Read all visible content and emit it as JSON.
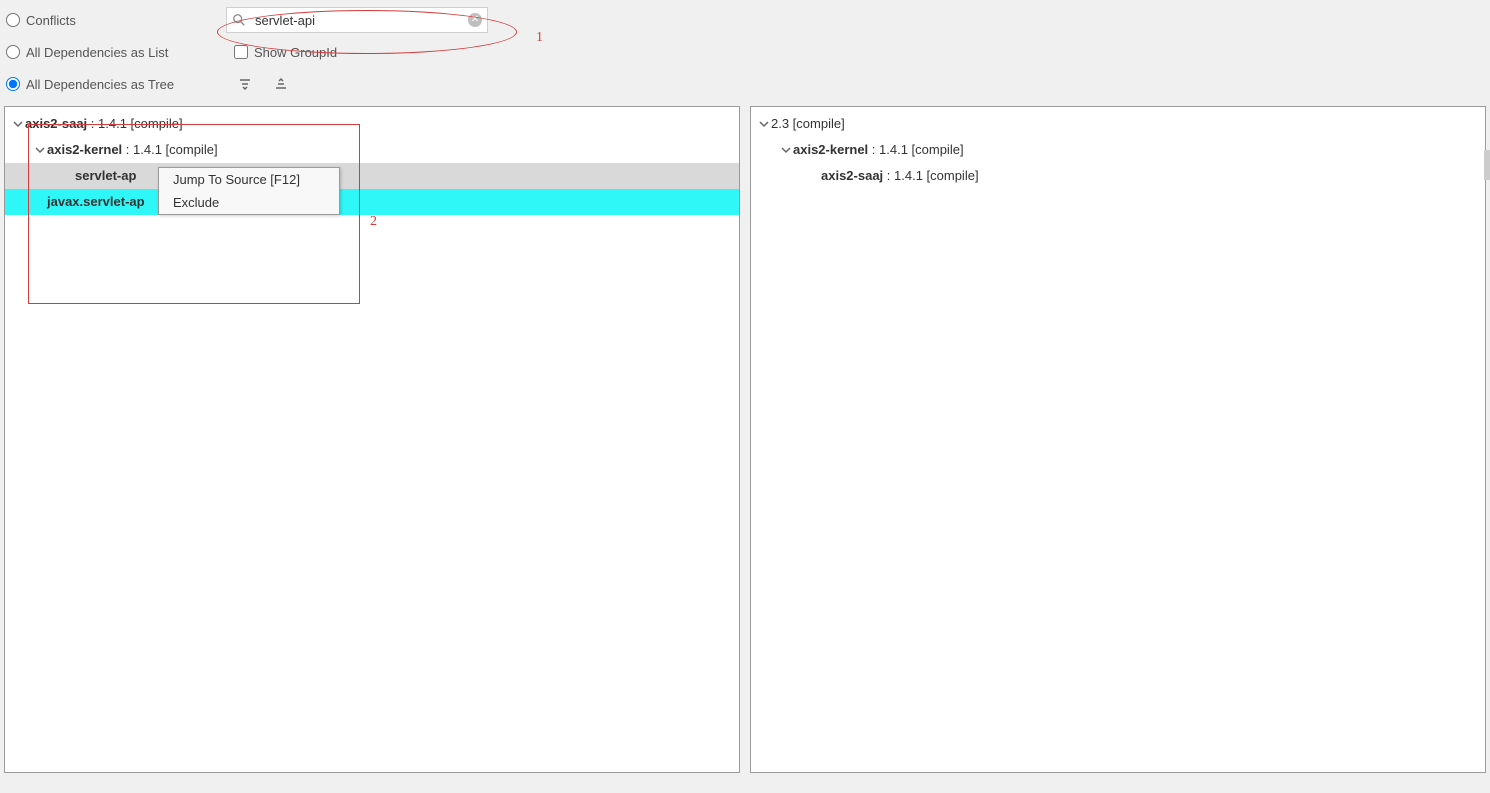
{
  "toolbar": {
    "conflicts_label": "Conflicts",
    "all_list_label": "All Dependencies as List",
    "all_tree_label": "All Dependencies as Tree",
    "show_groupid_label": "Show GroupId",
    "search_value": "servlet-api"
  },
  "annotations": {
    "num1": "1",
    "num2": "2"
  },
  "left_tree": {
    "n0": {
      "name": "axis2-saaj",
      "meta": " : 1.4.1 [compile]"
    },
    "n1": {
      "name": "axis2-kernel",
      "meta": " : 1.4.1 [compile]"
    },
    "n2": {
      "name": "servlet-ap",
      "meta": ""
    },
    "n3": {
      "name": "javax.servlet-ap",
      "meta": ""
    }
  },
  "right_tree": {
    "n0": {
      "name": "",
      "meta": "2.3 [compile]"
    },
    "n1": {
      "name": "axis2-kernel",
      "meta": " : 1.4.1 [compile]"
    },
    "n2": {
      "name": "axis2-saaj",
      "meta": " : 1.4.1 [compile]"
    }
  },
  "context_menu": {
    "jump": "Jump To Source [F12]",
    "exclude": "Exclude"
  }
}
